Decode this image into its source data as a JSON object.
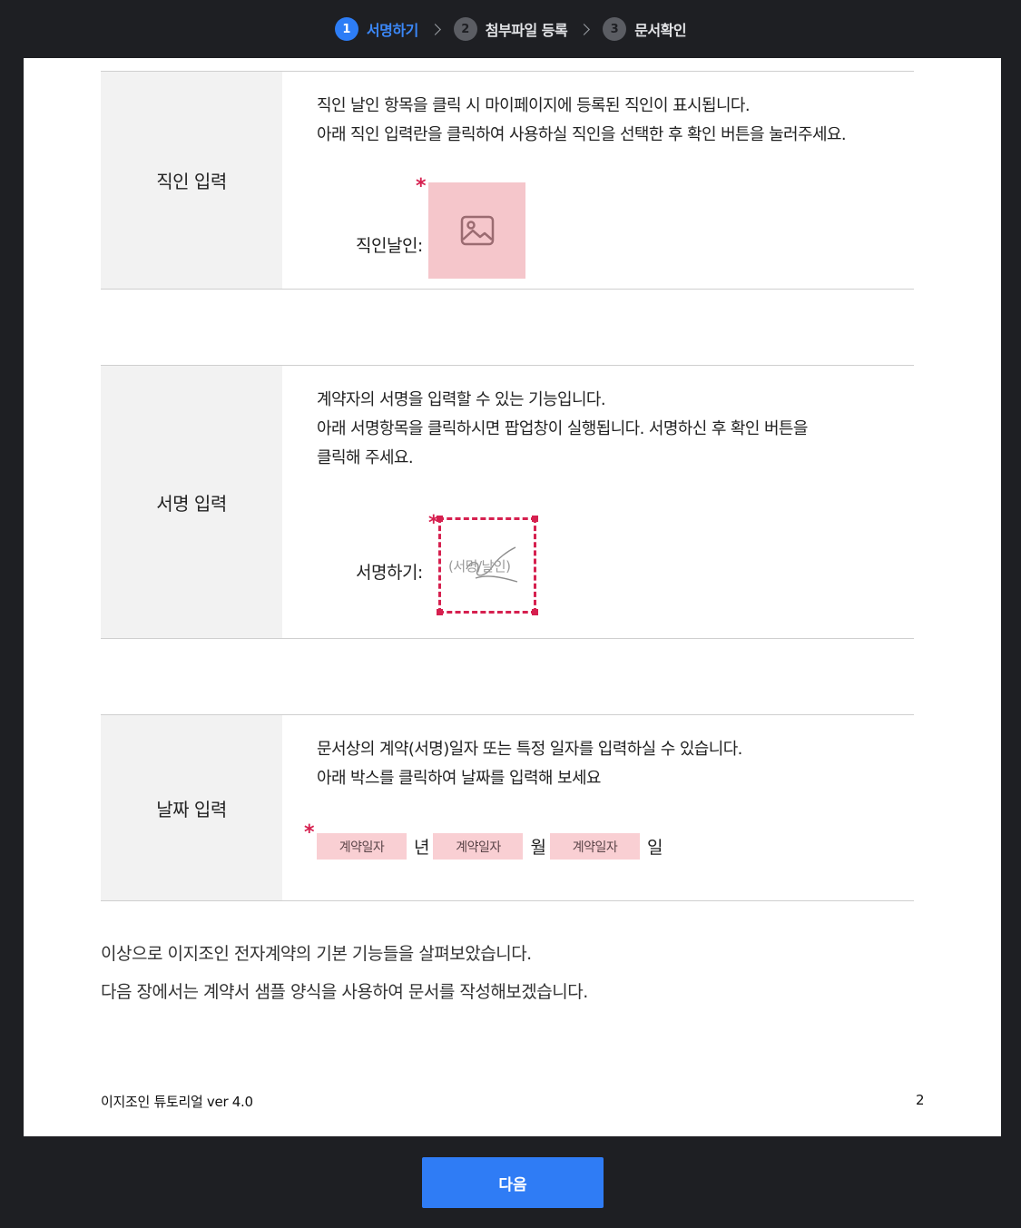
{
  "stepper": {
    "steps": [
      {
        "num": "1",
        "label": "서명하기"
      },
      {
        "num": "2",
        "label": "첨부파일 등록"
      },
      {
        "num": "3",
        "label": "문서확인"
      }
    ]
  },
  "sections": {
    "seal": {
      "heading": "직인 입력",
      "lines": [
        "직인 날인 항목을 클릭 시 마이페이지에 등록된 직인이 표시됩니다.",
        "아래 직인 입력란을 클릭하여 사용하실 직인을 선택한 후 확인 버튼을 눌러주세요."
      ],
      "field_label": "직인날인:",
      "required_mark": "*"
    },
    "signature": {
      "heading": "서명 입력",
      "lines": [
        "계약자의 서명을 입력할 수 있는 기능입니다.",
        "아래 서명항목을 클릭하시면 팝업창이 실행됩니다. 서명하신 후 확인 버튼을",
        "클릭해 주세요."
      ],
      "field_label": "서명하기:",
      "box_hint": "(서명/날인)",
      "required_mark": "*"
    },
    "date": {
      "heading": "날짜 입력",
      "lines": [
        "문서상의 계약(서명)일자 또는 특정 일자를 입력하실 수 있습니다.",
        "아래 박스를 클릭하여 날짜를 입력해 보세요"
      ],
      "required_mark": "*",
      "fields": [
        {
          "placeholder": "계약일자",
          "unit": "년"
        },
        {
          "placeholder": "계약일자",
          "unit": "월"
        },
        {
          "placeholder": "계약일자",
          "unit": "일"
        }
      ]
    }
  },
  "summary": {
    "line1": "이상으로 이지조인 전자계약의 기본 기능들을 살펴보았습니다.",
    "line2": "다음 장에서는 계약서 샘플 양식을 사용하여 문서를 작성해보겠습니다."
  },
  "footer": {
    "title": "이지조인 튜토리얼 ver 4.0",
    "page": "2"
  },
  "actions": {
    "next_label": "다음"
  },
  "colors": {
    "accent": "#2f7cf5",
    "required": "#d6204f",
    "seal_bg": "#f5c6cb",
    "date_bg": "#f9cfd3"
  }
}
